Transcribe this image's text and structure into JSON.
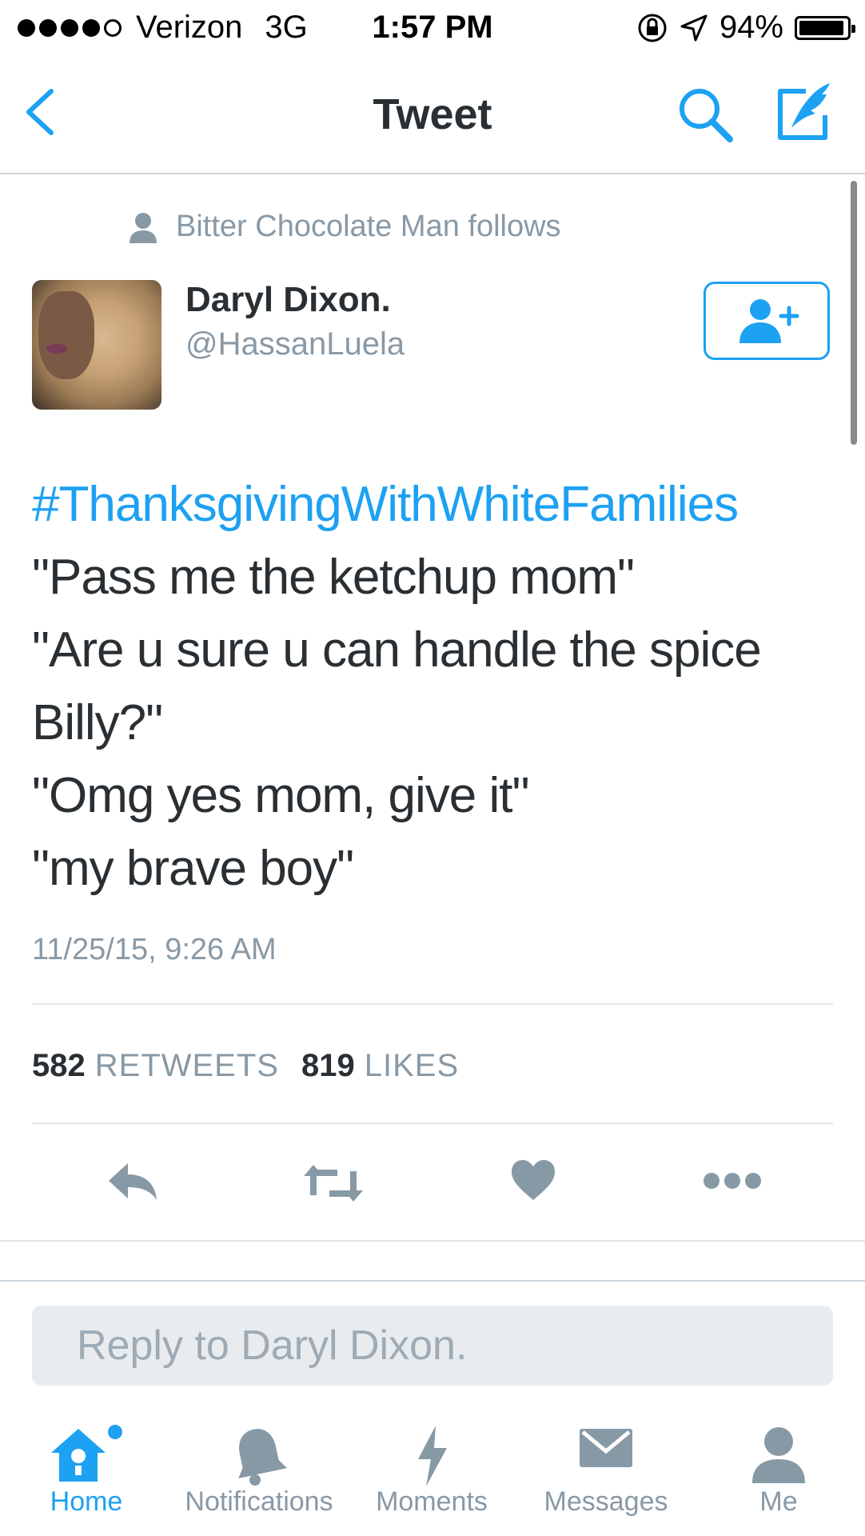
{
  "status_bar": {
    "carrier": "Verizon",
    "network": "3G",
    "time": "1:57 PM",
    "battery": "94%",
    "signal_bars_filled": 4,
    "signal_bars_total": 5
  },
  "nav": {
    "title": "Tweet",
    "back_icon": "chevron-left-icon",
    "search_icon": "search-icon",
    "compose_icon": "compose-icon"
  },
  "tweet": {
    "social_context": "Bitter Chocolate Man follows",
    "author_name": "Daryl Dixon.",
    "author_handle": "@HassanLuela",
    "hashtag": "#ThanksgivingWithWhiteFamilies",
    "lines": [
      "\"Pass me the ketchup mom\"",
      "\"Are u sure u can handle the spice",
      "Billy?\"",
      "\"Omg yes mom, give it\"",
      "\"my brave boy\""
    ],
    "timestamp": "11/25/15, 9:26 AM",
    "retweets_count": "582",
    "retweets_label": "RETWEETS",
    "likes_count": "819",
    "likes_label": "LIKES"
  },
  "reply": {
    "placeholder": "Reply to Daryl Dixon."
  },
  "tabs": [
    {
      "label": "Home",
      "icon": "home-icon",
      "active": true
    },
    {
      "label": "Notifications",
      "icon": "bell-icon",
      "active": false
    },
    {
      "label": "Moments",
      "icon": "lightning-icon",
      "active": false
    },
    {
      "label": "Messages",
      "icon": "envelope-icon",
      "active": false
    },
    {
      "label": "Me",
      "icon": "person-icon",
      "active": false
    }
  ],
  "colors": {
    "accent": "#1da1f2",
    "muted": "#8899a6",
    "text": "#292f33",
    "icon_gray": "#8899a6"
  }
}
